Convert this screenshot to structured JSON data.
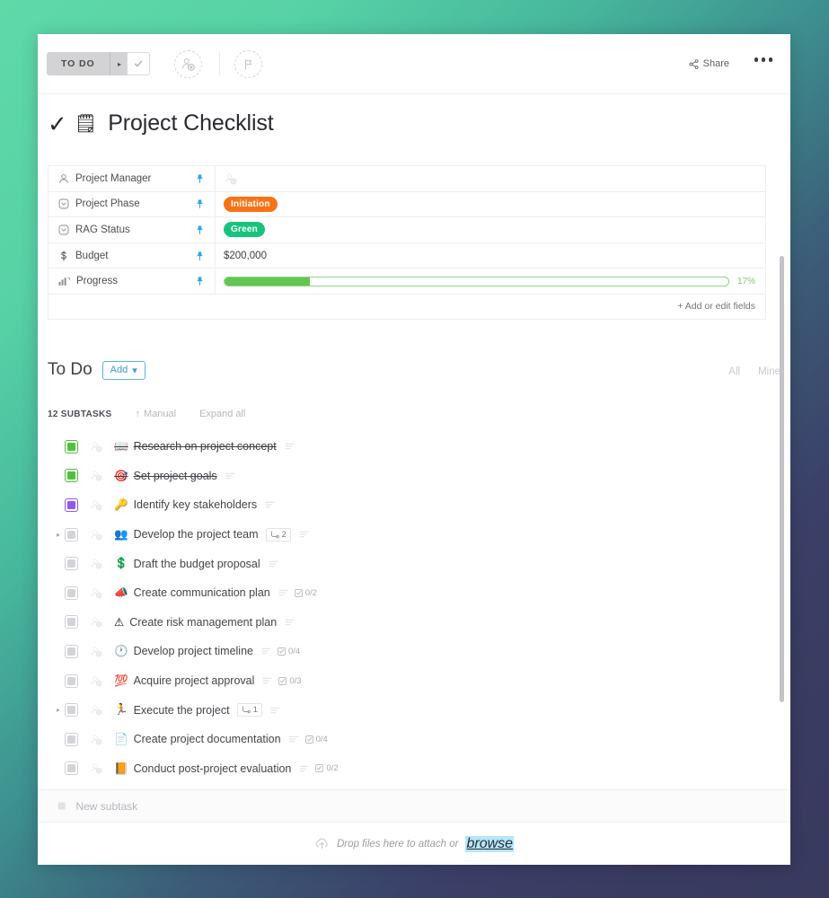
{
  "toolbar": {
    "status_label": "TO DO",
    "caret": "▸",
    "share_label": "Share",
    "check_icon": "check-icon",
    "assignee_icon": "add-assignee-icon",
    "flag_icon": "flag-icon",
    "more_icon": "more-options-icon"
  },
  "title": {
    "check": "✓",
    "emoji": "🗒",
    "text": "Project Checklist"
  },
  "fields": {
    "add_edit_label": "+ Add or edit fields",
    "rows": [
      {
        "name": "Project Manager",
        "icon": "person-icon",
        "type": "avatar",
        "value": ""
      },
      {
        "name": "Project Phase",
        "icon": "dropdown-icon",
        "type": "badge",
        "value": "Initiation",
        "color": "#f97316"
      },
      {
        "name": "RAG Status",
        "icon": "dropdown-icon",
        "type": "badge",
        "value": "Green",
        "color": "#17c47d"
      },
      {
        "name": "Budget",
        "icon": "dollar-icon",
        "type": "text",
        "value": "$200,000"
      },
      {
        "name": "Progress",
        "icon": "progress-icon",
        "type": "progress",
        "value": "17%",
        "percent": 17
      }
    ]
  },
  "todo": {
    "title": "To Do",
    "add_label": "Add",
    "add_caret": "▾",
    "filter_all": "All",
    "filter_mine": "Mine",
    "subtask_count": "12 SUBTASKS",
    "sort_label": "Manual",
    "sort_arrow": "↑",
    "expand_all": "Expand all"
  },
  "subtasks": [
    {
      "state": "done",
      "emoji": "📖",
      "name": "Research on project concept",
      "completed": true,
      "expandable": false,
      "chip": null,
      "checklist": null
    },
    {
      "state": "done",
      "emoji": "🎯",
      "name": "Set project goals",
      "completed": true,
      "expandable": false,
      "chip": null,
      "checklist": null
    },
    {
      "state": "prog",
      "emoji": "🔑",
      "name": "Identify key stakeholders",
      "completed": false,
      "expandable": false,
      "chip": null,
      "checklist": null
    },
    {
      "state": "todo",
      "emoji": "👥",
      "name": "Develop the project team",
      "completed": false,
      "expandable": true,
      "chip": "2",
      "checklist": null
    },
    {
      "state": "todo",
      "emoji": "💲",
      "name": "Draft the budget proposal",
      "completed": false,
      "expandable": false,
      "chip": null,
      "checklist": null
    },
    {
      "state": "todo",
      "emoji": "📣",
      "name": "Create communication plan",
      "completed": false,
      "expandable": false,
      "chip": null,
      "checklist": "0/2"
    },
    {
      "state": "todo",
      "emoji": "⚠",
      "name": "Create risk management plan",
      "completed": false,
      "expandable": false,
      "chip": null,
      "checklist": null
    },
    {
      "state": "todo",
      "emoji": "🕐",
      "name": "Develop project timeline",
      "completed": false,
      "expandable": false,
      "chip": null,
      "checklist": "0/4"
    },
    {
      "state": "todo",
      "emoji": "💯",
      "name": "Acquire project approval",
      "completed": false,
      "expandable": false,
      "chip": null,
      "checklist": "0/3"
    },
    {
      "state": "todo",
      "emoji": "🏃",
      "name": "Execute the project",
      "completed": false,
      "expandable": true,
      "chip": "1",
      "checklist": null
    },
    {
      "state": "todo",
      "emoji": "📄",
      "name": "Create project documentation",
      "completed": false,
      "expandable": false,
      "chip": null,
      "checklist": "0/4"
    },
    {
      "state": "todo",
      "emoji": "📙",
      "name": "Conduct post-project evaluation",
      "completed": false,
      "expandable": false,
      "chip": null,
      "checklist": "0/2"
    }
  ],
  "new_subtask": {
    "placeholder": "New subtask"
  },
  "dropzone": {
    "text": "Drop files here to attach or",
    "browse": "browse",
    "icon": "upload-cloud-icon"
  }
}
